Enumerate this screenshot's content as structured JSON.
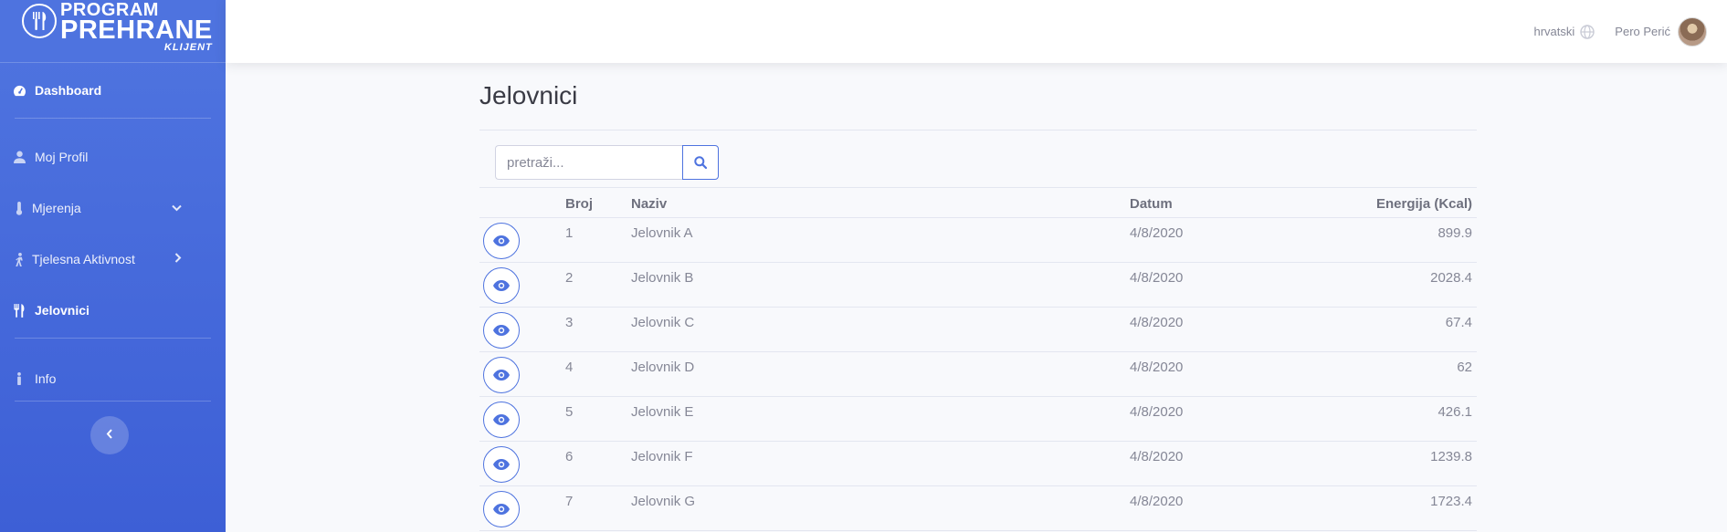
{
  "brand": {
    "line1": "PROGRAM",
    "line2": "PREHRANE",
    "line3": "KLIJENT"
  },
  "sidebar": {
    "items": [
      {
        "label": "Dashboard",
        "icon": "tachometer-icon"
      },
      {
        "label": "Moj Profil",
        "icon": "user-icon"
      },
      {
        "label": "Mjerenja",
        "icon": "thermometer-icon"
      },
      {
        "label": "Tjelesna Aktivnost",
        "icon": "walking-icon"
      },
      {
        "label": "Jelovnici",
        "icon": "utensils-icon"
      },
      {
        "label": "Info",
        "icon": "info-icon"
      }
    ]
  },
  "topbar": {
    "language": "hrvatski",
    "user_name": "Pero Perić"
  },
  "page": {
    "title": "Jelovnici"
  },
  "search": {
    "placeholder": "pretraži..."
  },
  "table": {
    "headers": {
      "broj": "Broj",
      "naziv": "Naziv",
      "datum": "Datum",
      "energija": "Energija (Kcal)"
    },
    "rows": [
      {
        "broj": "1",
        "naziv": "Jelovnik A",
        "datum": "4/8/2020",
        "energija": "899.9"
      },
      {
        "broj": "2",
        "naziv": "Jelovnik B",
        "datum": "4/8/2020",
        "energija": "2028.4"
      },
      {
        "broj": "3",
        "naziv": "Jelovnik C",
        "datum": "4/8/2020",
        "energija": "67.4"
      },
      {
        "broj": "4",
        "naziv": "Jelovnik D",
        "datum": "4/8/2020",
        "energija": "62"
      },
      {
        "broj": "5",
        "naziv": "Jelovnik E",
        "datum": "4/8/2020",
        "energija": "426.1"
      },
      {
        "broj": "6",
        "naziv": "Jelovnik F",
        "datum": "4/8/2020",
        "energija": "1239.8"
      },
      {
        "broj": "7",
        "naziv": "Jelovnik G",
        "datum": "4/8/2020",
        "energija": "1723.4"
      }
    ]
  },
  "colors": {
    "primary": "#4e73df",
    "sidebar_dark": "#3d5fd6",
    "text_muted": "#858796"
  }
}
